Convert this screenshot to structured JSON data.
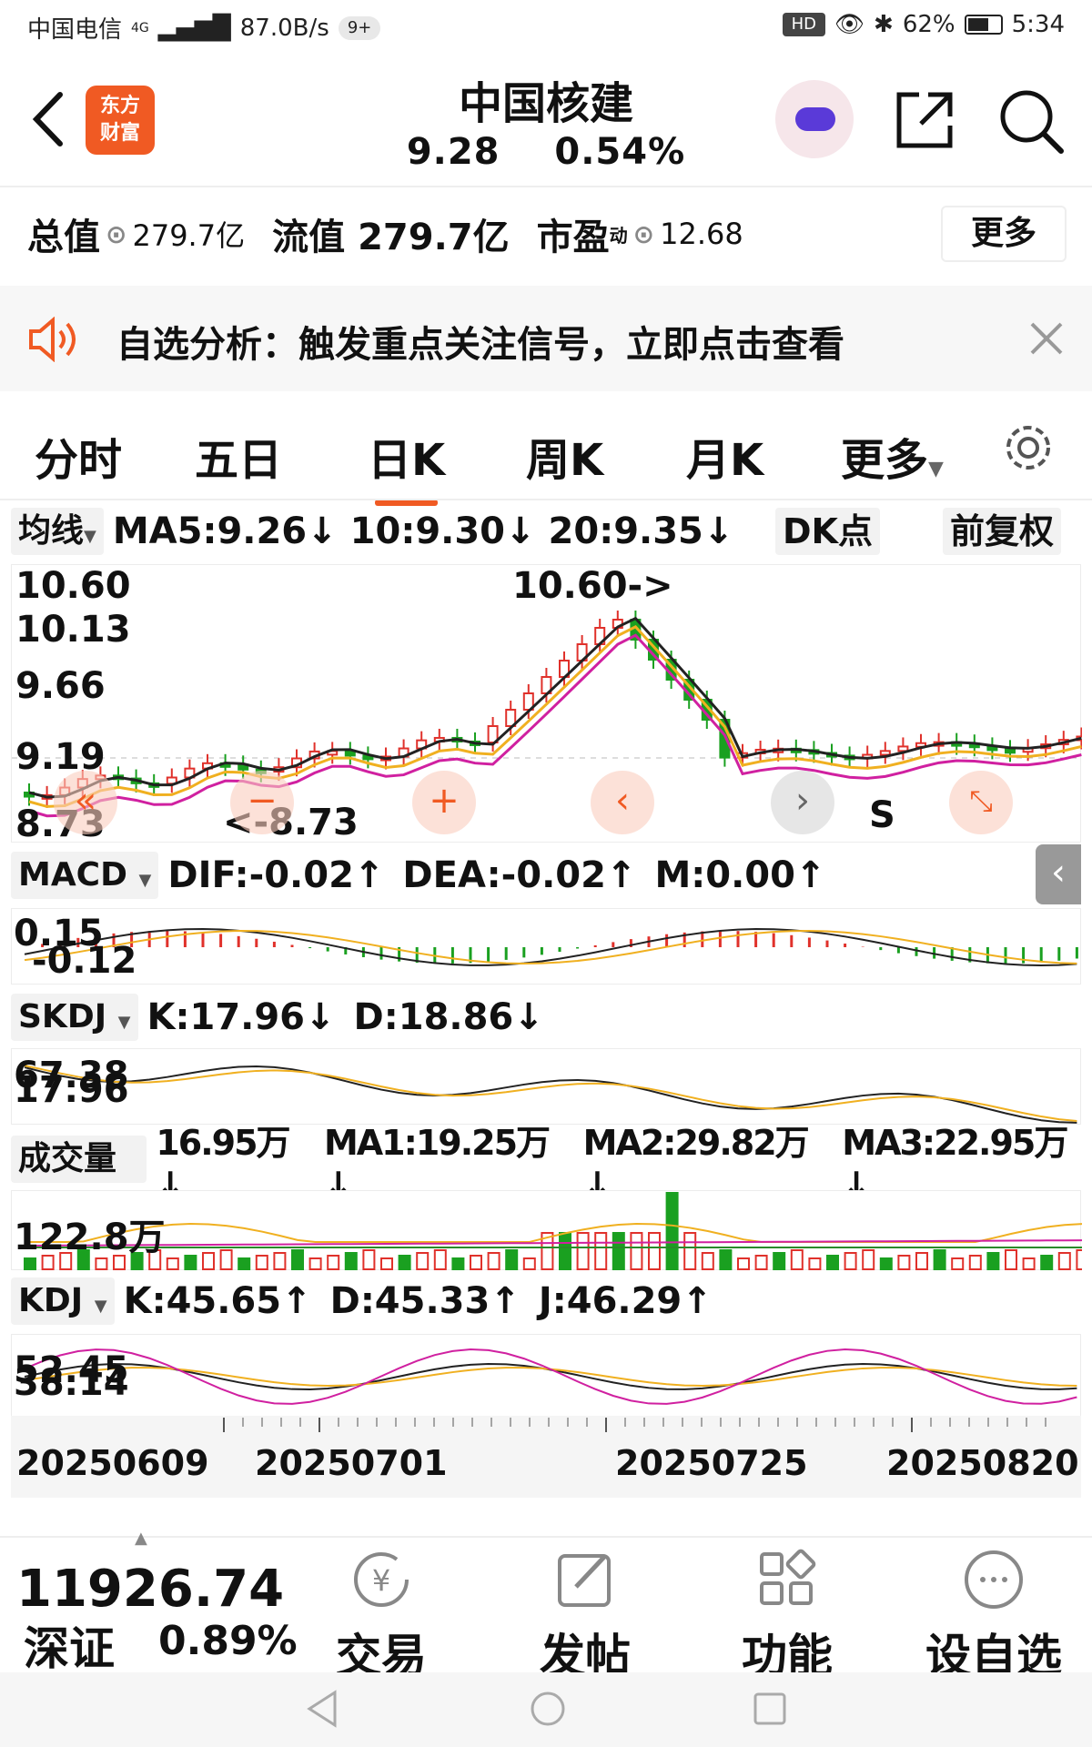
{
  "status_bar": {
    "carrier": "中国电信",
    "network": "4G",
    "speed": "87.0B/s",
    "notif": "9+",
    "hd": "HD",
    "battery": "62%",
    "time": "5:34"
  },
  "header": {
    "logo_line1": "东方",
    "logo_line2": "财富",
    "title": "中国核建",
    "price": "9.28",
    "change": "0.54%"
  },
  "info": {
    "total_label": "总值",
    "total_value": "279.7亿",
    "float_label": "流值",
    "float_value": "279.7亿",
    "pe_label": "市盈",
    "pe_sup": "动",
    "pe_value": "12.68",
    "more": "更多"
  },
  "banner": {
    "text": "自选分析：触发重点关注信号，立即点击查看"
  },
  "tabs": [
    "分时",
    "五日",
    "日K",
    "周K",
    "月K",
    "更多"
  ],
  "active_tab": 2,
  "ma_bar": {
    "selector": "均线",
    "ma5": "MA5:9.26↓",
    "ma10": "10:9.30↓",
    "ma20": "20:9.35↓",
    "dk": "DK点",
    "adjust": "前复权"
  },
  "price_axis": [
    "10.60",
    "10.13",
    "9.66",
    "9.19",
    "8.73"
  ],
  "annotations": {
    "high": "10.60->",
    "low": "<-8.73",
    "signal": "S"
  },
  "macd_bar": {
    "name": "MACD",
    "dif": "DIF:-0.02↑",
    "dea": "DEA:-0.02↑",
    "m": "M:0.00↑",
    "axis_top": "0.15",
    "axis_bottom": "-0.12"
  },
  "skdj_bar": {
    "name": "SKDJ",
    "k": "K:17.96↓",
    "d": "D:18.86↓",
    "axis_top": "67.38",
    "axis_bottom": "17.96"
  },
  "vol_bar": {
    "name": "成交量",
    "v": "16.95万↓",
    "ma1": "MA1:19.25万↓",
    "ma2": "MA2:29.82万↓",
    "ma3": "MA3:22.95万↓",
    "axis_top": "122.8万"
  },
  "kdj_bar": {
    "name": "KDJ",
    "k": "K:45.65↑",
    "d": "D:45.33↑",
    "j": "J:46.29↑",
    "axis_top": "52.45",
    "axis_bottom": "38.14"
  },
  "dates": [
    "20250609",
    "20250701",
    "20250725",
    "20250820"
  ],
  "bottom": {
    "index_value": "11926.74",
    "index_name": "深证",
    "index_change": "0.89%",
    "tools": [
      "交易",
      "发帖",
      "功能",
      "设自选"
    ]
  },
  "colors": {
    "up": "#e0312b",
    "down": "#1aa020",
    "ma5": "#222222",
    "ma10": "#f0b020",
    "ma20": "#d020a0",
    "accent": "#f05a23"
  }
}
